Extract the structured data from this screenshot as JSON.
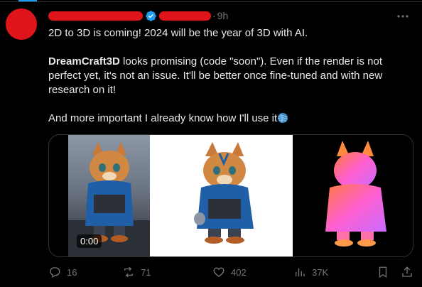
{
  "tweet": {
    "time": "9h",
    "dot": "·",
    "line1": "2D to 3D is coming! 2024 will be the year of 3D with AI.",
    "para2_bold": "DreamCraft3D",
    "para2_rest": " looks promising (code \"soon\"). Even if the render is not perfect yet, it's not an issue. It'll be better once fine-tuned and with new research on it!",
    "line3": "And more important I already know how I'll use it"
  },
  "media": {
    "duration": "0:00"
  },
  "actions": {
    "replies": "16",
    "reposts": "71",
    "likes": "402",
    "views": "37K"
  },
  "colors": {
    "accent": "#1d9bf0",
    "redaction": "#e0151b",
    "muted": "#71767b",
    "text": "#e7e9ea"
  },
  "icons": [
    "verified-icon",
    "more-icon",
    "yarn-emoji",
    "reply-icon",
    "repost-icon",
    "like-icon",
    "views-icon",
    "bookmark-icon",
    "share-icon"
  ]
}
